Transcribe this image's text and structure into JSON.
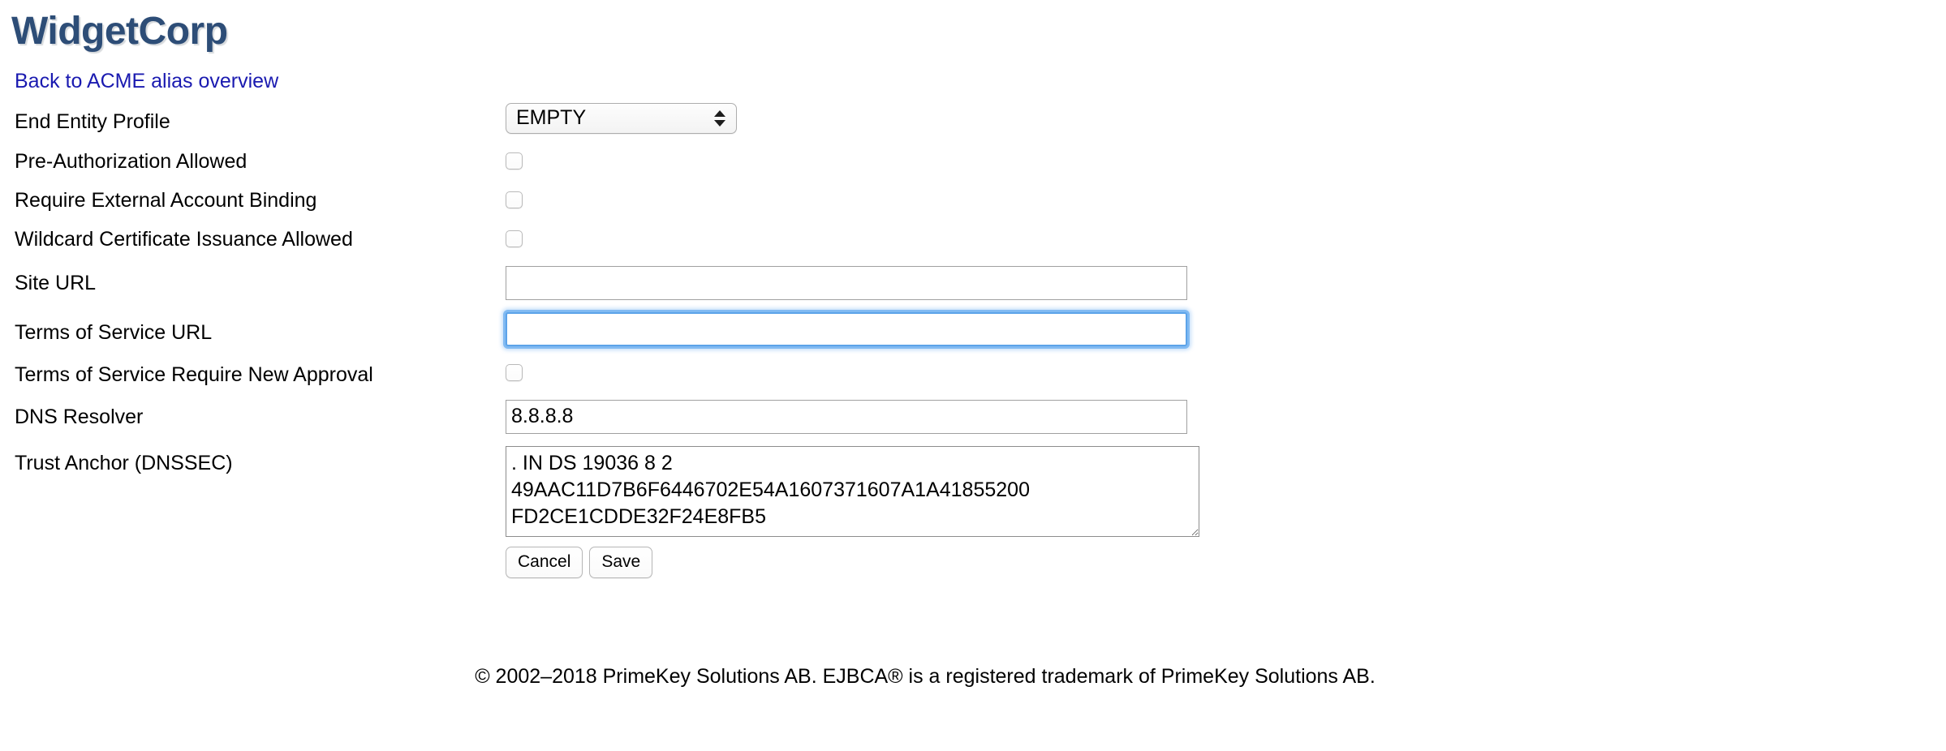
{
  "header": {
    "brand_title": "WidgetCorp",
    "brand_color": "#2d4d77"
  },
  "nav": {
    "back_link": "Back to ACME alias overview",
    "link_color": "#1a1ab0"
  },
  "form": {
    "end_entity_profile": {
      "label": "End Entity Profile",
      "selected": "EMPTY",
      "options": [
        "EMPTY"
      ]
    },
    "pre_authorization_allowed": {
      "label": "Pre-Authorization Allowed",
      "checked": false
    },
    "require_external_account_binding": {
      "label": "Require External Account Binding",
      "checked": false
    },
    "wildcard_certificate_issuance_allowed": {
      "label": "Wildcard Certificate Issuance Allowed",
      "checked": false
    },
    "site_url": {
      "label": "Site URL",
      "value": "",
      "placeholder": ""
    },
    "terms_of_service_url": {
      "label": "Terms of Service URL",
      "value": "",
      "placeholder": "",
      "focused": true,
      "focus_ring_color": "#5ca3e9"
    },
    "terms_of_service_require_new_approval": {
      "label": "Terms of Service Require New Approval",
      "checked": false
    },
    "dns_resolver": {
      "label": "DNS Resolver",
      "value": "8.8.8.8",
      "placeholder": ""
    },
    "trust_anchor": {
      "label": "Trust Anchor (DNSSEC)",
      "value": ". IN DS 19036 8 2\n49AAC11D7B6F6446702E54A1607371607A1A41855200\nFD2CE1CDDE32F24E8FB5"
    }
  },
  "actions": {
    "cancel_label": "Cancel",
    "save_label": "Save"
  },
  "footer": {
    "copyright": "© 2002–2018 PrimeKey Solutions AB. EJBCA® is a registered trademark of PrimeKey Solutions AB."
  }
}
